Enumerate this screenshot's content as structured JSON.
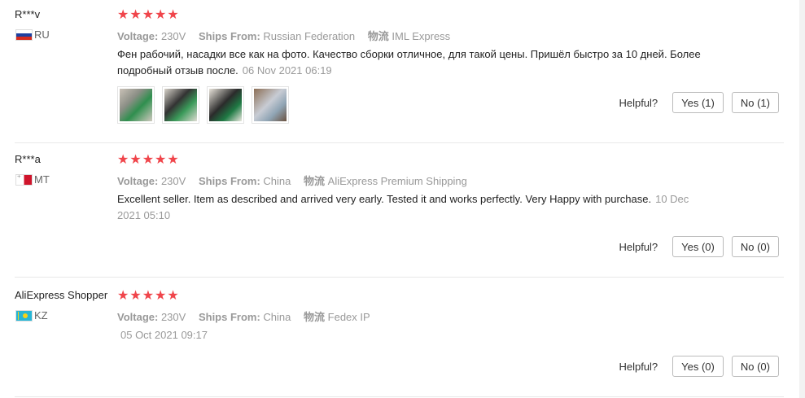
{
  "helpful_label": "Helpful?",
  "attr_labels": {
    "voltage": "Voltage:",
    "ships_from": "Ships From:",
    "shipping": "物流"
  },
  "star_glyph": "★",
  "reviews": [
    {
      "user": "R***v",
      "country_code": "RU",
      "rating": 5,
      "voltage": "230V",
      "ships_from": "Russian Federation",
      "shipping": "IML Express",
      "comment": "Фен рабочий, насадки все как на фото. Качество сборки отличное, для такой цены. Пришёл быстро за 10 дней. Более подробный отзыв после.",
      "date": "06 Nov 2021 06:19",
      "yes": "Yes (1)",
      "no": "No (1)",
      "photos": 4
    },
    {
      "user": "R***a",
      "country_code": "MT",
      "rating": 5,
      "voltage": "230V",
      "ships_from": "China",
      "shipping": "AliExpress Premium Shipping",
      "comment": "Excellent seller. Item as described and arrived very early. Tested it and works perfectly. Very Happy with purchase.",
      "date": "10 Dec 2021 05:10",
      "yes": "Yes (0)",
      "no": "No (0)",
      "photos": 0
    },
    {
      "user": "AliExpress Shopper",
      "country_code": "KZ",
      "rating": 5,
      "voltage": "230V",
      "ships_from": "China",
      "shipping": "Fedex IP",
      "comment": "",
      "date": "05 Oct 2021 09:17",
      "yes": "Yes (0)",
      "no": "No (0)",
      "photos": 0
    }
  ]
}
